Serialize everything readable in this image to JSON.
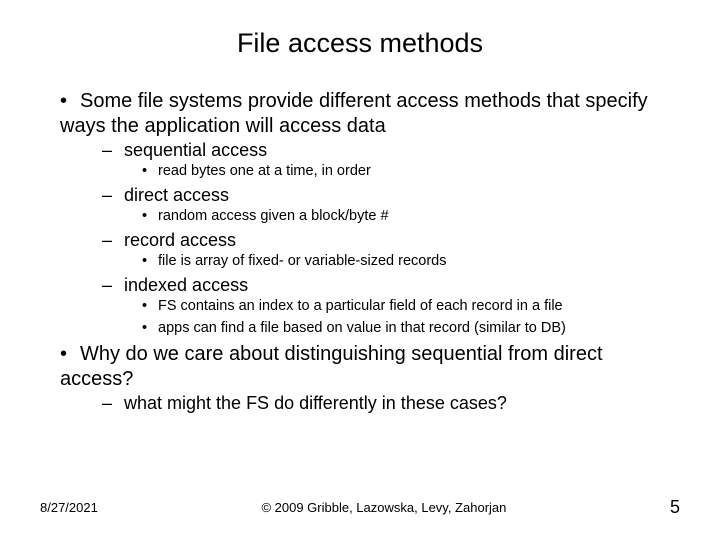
{
  "title": "File access methods",
  "bullets": {
    "b1": "Some file systems provide different access methods that specify ways the application will access data",
    "b1_1": "sequential access",
    "b1_1_1": "read bytes one at a time, in order",
    "b1_2": "direct access",
    "b1_2_1": "random access given a block/byte #",
    "b1_3": "record access",
    "b1_3_1": "file is array of fixed- or variable-sized records",
    "b1_4": "indexed access",
    "b1_4_1": "FS contains an index to a particular field of each record in a file",
    "b1_4_2": "apps can find a file based on value in that record (similar to DB)",
    "b2": "Why do we care about distinguishing sequential from direct access?",
    "b2_1": "what might the FS do differently in these cases?"
  },
  "footer": {
    "date": "8/27/2021",
    "copyright": "© 2009 Gribble, Lazowska, Levy, Zahorjan",
    "page": "5"
  }
}
